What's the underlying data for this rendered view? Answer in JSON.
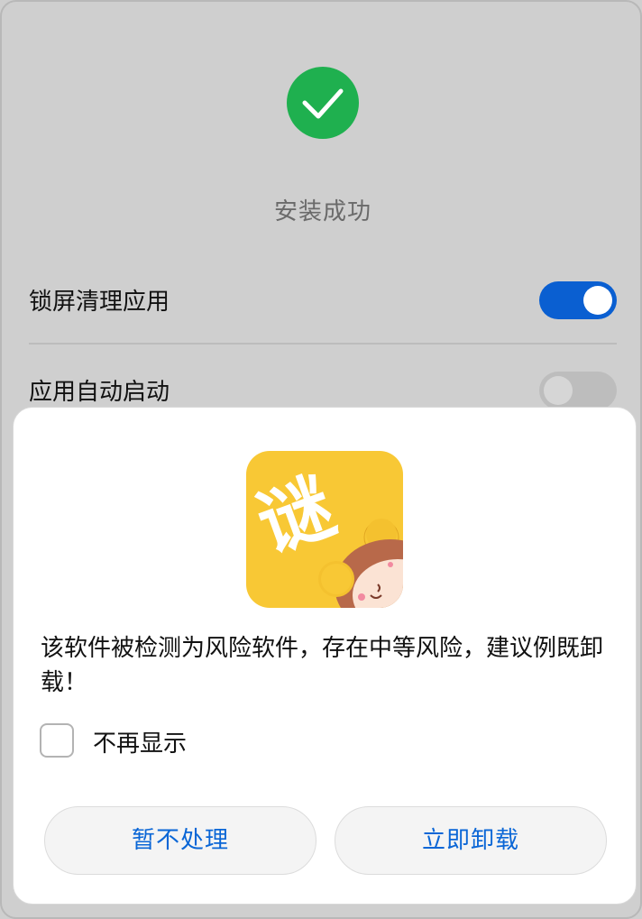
{
  "status": {
    "icon": "checkmark-icon",
    "icon_color": "#1fb04f",
    "text": "安装成功"
  },
  "settings": [
    {
      "label": "锁屏清理应用",
      "enabled": true
    },
    {
      "label": "应用自动启动",
      "enabled": false
    }
  ],
  "dialog": {
    "app_icon": {
      "glyph": "谜",
      "bg_color": "#f8c835"
    },
    "message": "该软件被检测为风险软件，存在中等风险，建议例既卸载！",
    "dont_show_again": {
      "label": "不再显示",
      "checked": false
    },
    "buttons": {
      "later": "暂不处理",
      "uninstall": "立即卸载"
    },
    "button_text_color": "#0a66d6"
  },
  "toggle_on_color": "#0a5fd1"
}
